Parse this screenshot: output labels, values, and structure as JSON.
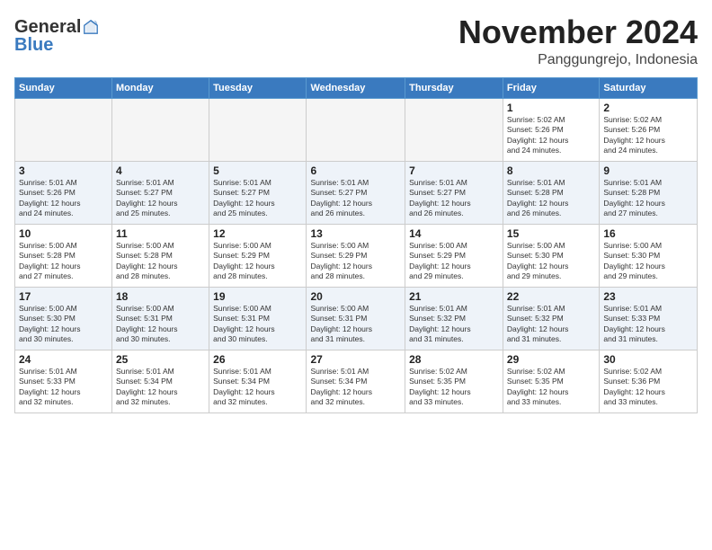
{
  "header": {
    "logo_general": "General",
    "logo_blue": "Blue",
    "month": "November 2024",
    "location": "Panggungrejo, Indonesia"
  },
  "weekdays": [
    "Sunday",
    "Monday",
    "Tuesday",
    "Wednesday",
    "Thursday",
    "Friday",
    "Saturday"
  ],
  "weeks": [
    [
      {
        "day": "",
        "info": ""
      },
      {
        "day": "",
        "info": ""
      },
      {
        "day": "",
        "info": ""
      },
      {
        "day": "",
        "info": ""
      },
      {
        "day": "",
        "info": ""
      },
      {
        "day": "1",
        "info": "Sunrise: 5:02 AM\nSunset: 5:26 PM\nDaylight: 12 hours\nand 24 minutes."
      },
      {
        "day": "2",
        "info": "Sunrise: 5:02 AM\nSunset: 5:26 PM\nDaylight: 12 hours\nand 24 minutes."
      }
    ],
    [
      {
        "day": "3",
        "info": "Sunrise: 5:01 AM\nSunset: 5:26 PM\nDaylight: 12 hours\nand 24 minutes."
      },
      {
        "day": "4",
        "info": "Sunrise: 5:01 AM\nSunset: 5:27 PM\nDaylight: 12 hours\nand 25 minutes."
      },
      {
        "day": "5",
        "info": "Sunrise: 5:01 AM\nSunset: 5:27 PM\nDaylight: 12 hours\nand 25 minutes."
      },
      {
        "day": "6",
        "info": "Sunrise: 5:01 AM\nSunset: 5:27 PM\nDaylight: 12 hours\nand 26 minutes."
      },
      {
        "day": "7",
        "info": "Sunrise: 5:01 AM\nSunset: 5:27 PM\nDaylight: 12 hours\nand 26 minutes."
      },
      {
        "day": "8",
        "info": "Sunrise: 5:01 AM\nSunset: 5:28 PM\nDaylight: 12 hours\nand 26 minutes."
      },
      {
        "day": "9",
        "info": "Sunrise: 5:01 AM\nSunset: 5:28 PM\nDaylight: 12 hours\nand 27 minutes."
      }
    ],
    [
      {
        "day": "10",
        "info": "Sunrise: 5:00 AM\nSunset: 5:28 PM\nDaylight: 12 hours\nand 27 minutes."
      },
      {
        "day": "11",
        "info": "Sunrise: 5:00 AM\nSunset: 5:28 PM\nDaylight: 12 hours\nand 28 minutes."
      },
      {
        "day": "12",
        "info": "Sunrise: 5:00 AM\nSunset: 5:29 PM\nDaylight: 12 hours\nand 28 minutes."
      },
      {
        "day": "13",
        "info": "Sunrise: 5:00 AM\nSunset: 5:29 PM\nDaylight: 12 hours\nand 28 minutes."
      },
      {
        "day": "14",
        "info": "Sunrise: 5:00 AM\nSunset: 5:29 PM\nDaylight: 12 hours\nand 29 minutes."
      },
      {
        "day": "15",
        "info": "Sunrise: 5:00 AM\nSunset: 5:30 PM\nDaylight: 12 hours\nand 29 minutes."
      },
      {
        "day": "16",
        "info": "Sunrise: 5:00 AM\nSunset: 5:30 PM\nDaylight: 12 hours\nand 29 minutes."
      }
    ],
    [
      {
        "day": "17",
        "info": "Sunrise: 5:00 AM\nSunset: 5:30 PM\nDaylight: 12 hours\nand 30 minutes."
      },
      {
        "day": "18",
        "info": "Sunrise: 5:00 AM\nSunset: 5:31 PM\nDaylight: 12 hours\nand 30 minutes."
      },
      {
        "day": "19",
        "info": "Sunrise: 5:00 AM\nSunset: 5:31 PM\nDaylight: 12 hours\nand 30 minutes."
      },
      {
        "day": "20",
        "info": "Sunrise: 5:00 AM\nSunset: 5:31 PM\nDaylight: 12 hours\nand 31 minutes."
      },
      {
        "day": "21",
        "info": "Sunrise: 5:01 AM\nSunset: 5:32 PM\nDaylight: 12 hours\nand 31 minutes."
      },
      {
        "day": "22",
        "info": "Sunrise: 5:01 AM\nSunset: 5:32 PM\nDaylight: 12 hours\nand 31 minutes."
      },
      {
        "day": "23",
        "info": "Sunrise: 5:01 AM\nSunset: 5:33 PM\nDaylight: 12 hours\nand 31 minutes."
      }
    ],
    [
      {
        "day": "24",
        "info": "Sunrise: 5:01 AM\nSunset: 5:33 PM\nDaylight: 12 hours\nand 32 minutes."
      },
      {
        "day": "25",
        "info": "Sunrise: 5:01 AM\nSunset: 5:34 PM\nDaylight: 12 hours\nand 32 minutes."
      },
      {
        "day": "26",
        "info": "Sunrise: 5:01 AM\nSunset: 5:34 PM\nDaylight: 12 hours\nand 32 minutes."
      },
      {
        "day": "27",
        "info": "Sunrise: 5:01 AM\nSunset: 5:34 PM\nDaylight: 12 hours\nand 32 minutes."
      },
      {
        "day": "28",
        "info": "Sunrise: 5:02 AM\nSunset: 5:35 PM\nDaylight: 12 hours\nand 33 minutes."
      },
      {
        "day": "29",
        "info": "Sunrise: 5:02 AM\nSunset: 5:35 PM\nDaylight: 12 hours\nand 33 minutes."
      },
      {
        "day": "30",
        "info": "Sunrise: 5:02 AM\nSunset: 5:36 PM\nDaylight: 12 hours\nand 33 minutes."
      }
    ]
  ]
}
